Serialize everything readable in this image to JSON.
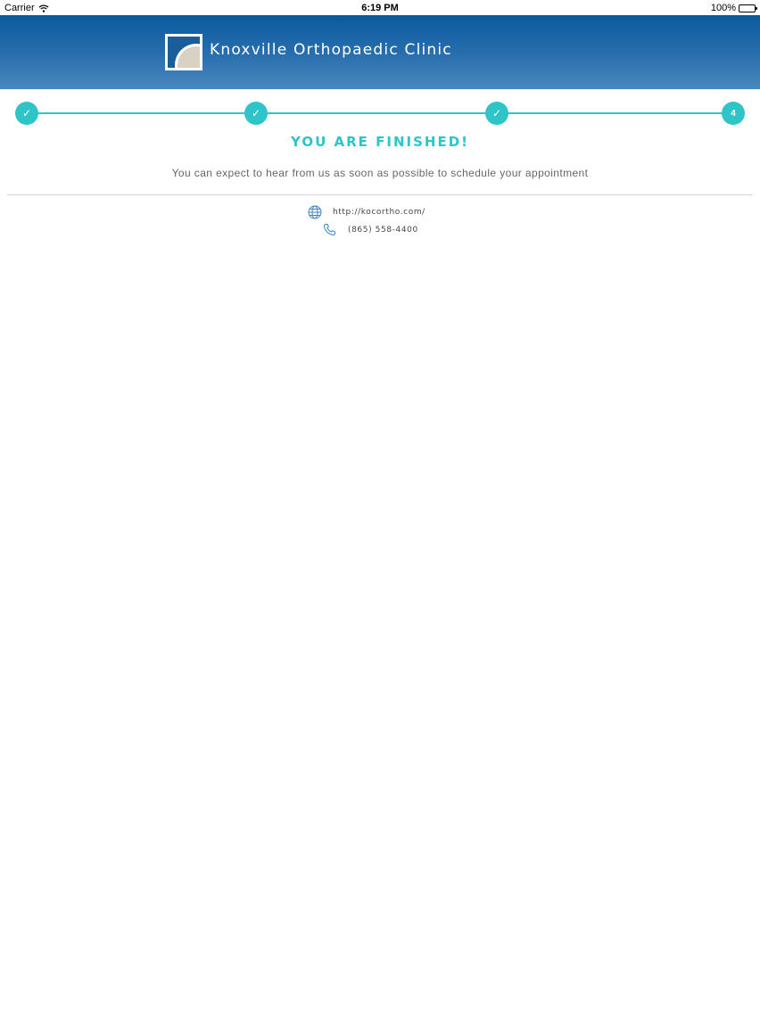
{
  "status_bar": {
    "carrier": "Carrier",
    "time": "6:19 PM",
    "battery": "100%"
  },
  "header": {
    "title": "Knoxville Orthopaedic Clinic",
    "logo_icon": "clinic-logo"
  },
  "stepper": {
    "steps": [
      {
        "state": "complete",
        "label": "✓"
      },
      {
        "state": "complete",
        "label": "✓"
      },
      {
        "state": "complete",
        "label": "✓"
      },
      {
        "state": "current",
        "label": "4"
      }
    ],
    "accent_color": "#2ec4c8"
  },
  "main": {
    "title": "YOU ARE FINISHED!",
    "message": "You can expect to hear from us as soon as possible to schedule your appointment"
  },
  "contact": {
    "website": "http://kocortho.com/",
    "phone": "(865) 558-4400",
    "website_icon": "globe-icon",
    "phone_icon": "phone-icon"
  },
  "colors": {
    "header_top": "#0a5a9e",
    "header_bottom": "#4a87bf",
    "accent": "#2ec4c8"
  }
}
